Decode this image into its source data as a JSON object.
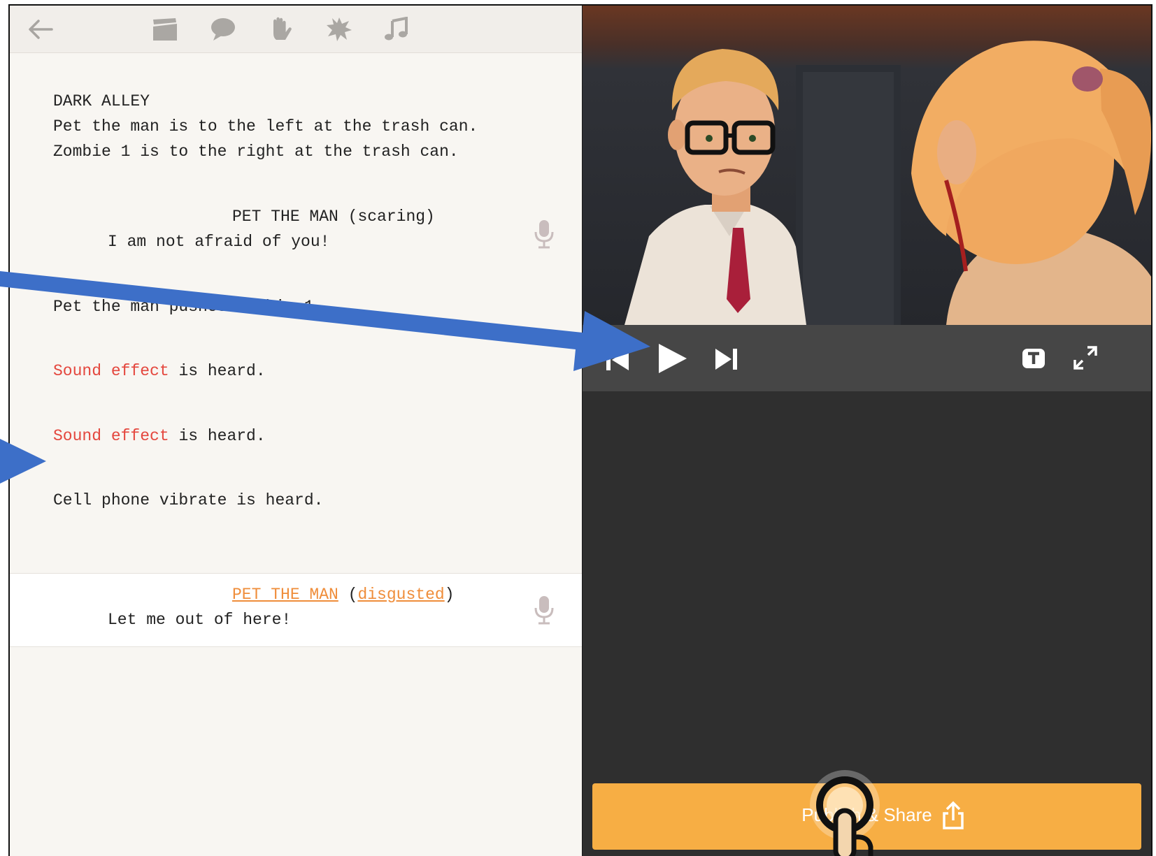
{
  "toolbar": {
    "icons": [
      "back-arrow-icon",
      "clapperboard-icon",
      "speech-bubble-icon",
      "hand-icon",
      "burst-icon",
      "music-note-icon"
    ]
  },
  "script": {
    "scene_heading": "DARK ALLEY",
    "action_1": "Pet the man is to the left at the trash can.",
    "action_2": "Zombie 1 is to the right at the trash can.",
    "dialogue_1": {
      "character": "PET THE MAN",
      "emotion": "(scaring)",
      "line": "I am not afraid of you!"
    },
    "action_3": "Pet the man pushes Zombie 1",
    "sfx_1": {
      "label": "Sound effect",
      "rest": " is heard."
    },
    "sfx_2": {
      "label": "Sound effect",
      "rest": " is heard."
    },
    "action_4": "Cell phone vibrate is heard.",
    "dialogue_2": {
      "character": "PET THE MAN",
      "open_paren": "(",
      "emotion": "disgusted",
      "close_paren": ")",
      "line": "Let me out of here!"
    }
  },
  "player": {
    "controls": [
      "skip-back-icon",
      "play-icon",
      "skip-forward-icon",
      "captions-icon",
      "fullscreen-icon"
    ]
  },
  "publish": {
    "label": "Publish & Share",
    "icon": "share-icon"
  },
  "colors": {
    "sfx": "#e4473e",
    "link": "#ef8d3a",
    "publish": "#f7ae44",
    "annotation_arrow": "#3d6fc8"
  }
}
